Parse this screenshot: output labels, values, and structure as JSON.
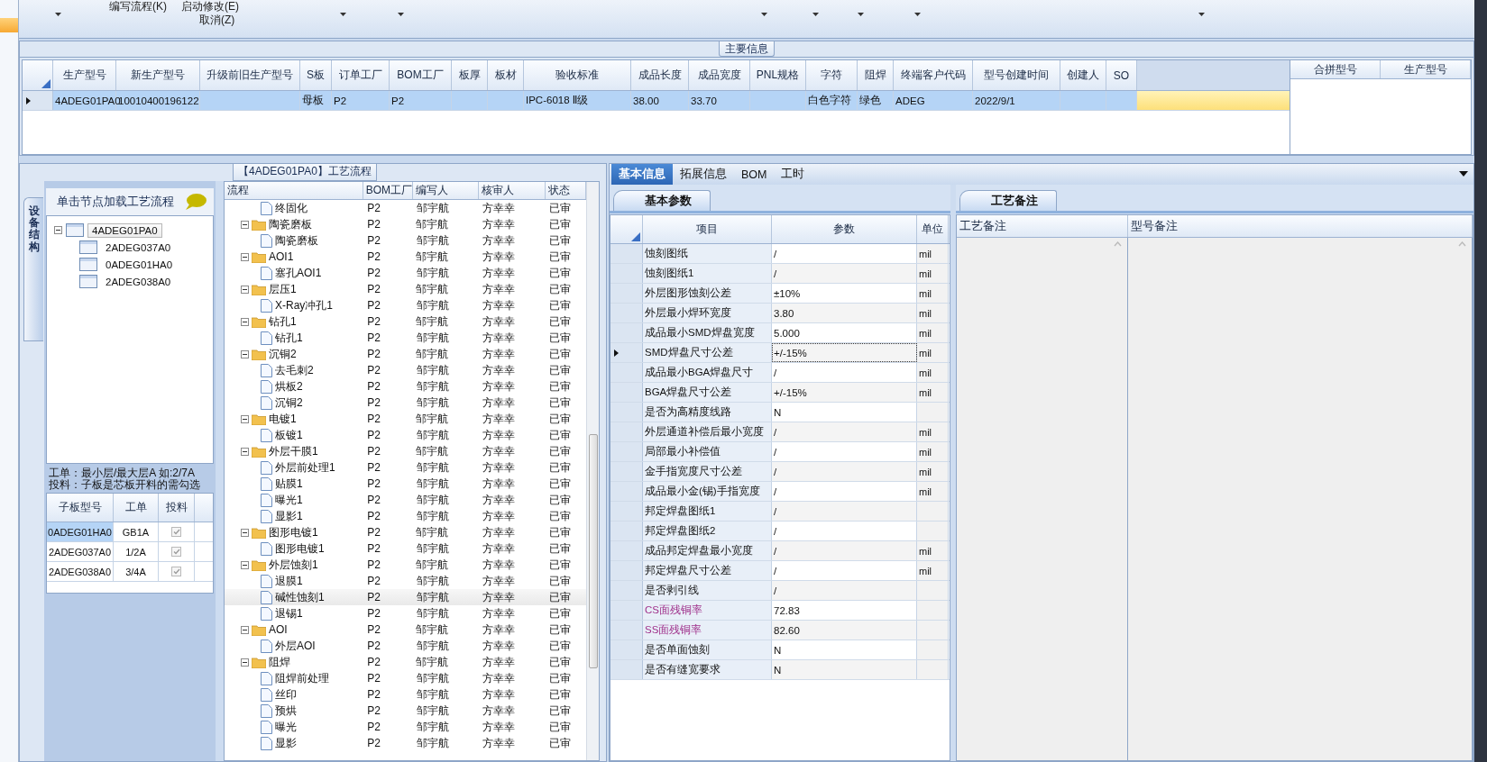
{
  "toolbar": {
    "buttons": [
      {
        "label": "编写流程(K)"
      },
      {
        "label": "启动修改(E)"
      },
      {
        "label": "取消(Z)"
      }
    ]
  },
  "main_info": {
    "title": "主要信息",
    "row_selected": true,
    "columns": [
      {
        "label": "生产型号",
        "value": "4ADEG01PA0"
      },
      {
        "label": "新生产型号",
        "value": "10010400196122"
      },
      {
        "label": "升级前旧生产型号"
      },
      {
        "label": "S板",
        "value": "母板"
      },
      {
        "label": "订单工厂",
        "value": "P2"
      },
      {
        "label": "BOM工厂",
        "value": "P2"
      },
      {
        "label": "板厚"
      },
      {
        "label": "板材"
      },
      {
        "label": "验收标准",
        "value": "IPC-6018 Ⅱ级"
      },
      {
        "label": "成品长度",
        "value": "38.00"
      },
      {
        "label": "成品宽度",
        "value": "33.70"
      },
      {
        "label": "PNL规格"
      },
      {
        "label": "字符",
        "value": "白色字符"
      },
      {
        "label": "阻焊",
        "value": "绿色"
      },
      {
        "label": "终端客户代码",
        "value": "ADEG"
      },
      {
        "label": "型号创建时间",
        "value": "2022/9/1"
      },
      {
        "label": "创建人"
      },
      {
        "label": "SO"
      }
    ],
    "merge_columns": [
      "合拼型号",
      "生产型号"
    ]
  },
  "process": {
    "title": "【4ADEG01PA0】工艺流程",
    "side_tab": "设备结构",
    "hint": "单击节点加载工艺流程",
    "tree": {
      "label": "4ADEG01PA0",
      "expanded": true,
      "selected": true,
      "children": [
        {
          "label": "2ADEG037A0",
          "selected": false
        },
        {
          "label": "0ADEG01HA0",
          "selected": false
        },
        {
          "label": "2ADEG038A0",
          "selected": false
        }
      ]
    },
    "notes": [
      "工单：最小层/最大层A 如:2/7A",
      "投料：子板是芯板开料的需勾选"
    ],
    "sub_columns": [
      "子板型号",
      "工单",
      "投料"
    ],
    "sub_rows": [
      {
        "model": "0ADEG01HA0",
        "order": "GB1A",
        "checked": true,
        "selected": true
      },
      {
        "model": "2ADEG037A0",
        "order": "1/2A",
        "checked": true,
        "selected": false
      },
      {
        "model": "2ADEG038A0",
        "order": "3/4A",
        "checked": true,
        "selected": false
      }
    ],
    "columns": [
      "流程",
      "BOM工厂",
      "编写人",
      "核审人",
      "状态"
    ],
    "groups": [
      {
        "children": [
          {
            "name": "终固化",
            "bom": "P2",
            "writer": "邹宇航",
            "reviewer": "方幸幸",
            "status": "已审",
            "selected": false
          }
        ]
      },
      {
        "name": "陶瓷磨板",
        "bom": "P2",
        "writer": "邹宇航",
        "reviewer": "方幸幸",
        "status": "已审",
        "selected": false,
        "expanded": true,
        "children": [
          {
            "name": "陶瓷磨板",
            "bom": "P2",
            "writer": "邹宇航",
            "reviewer": "方幸幸",
            "status": "已审",
            "selected": false
          }
        ]
      },
      {
        "name": "AOI1",
        "bom": "P2",
        "writer": "邹宇航",
        "reviewer": "方幸幸",
        "status": "已审",
        "selected": false,
        "expanded": true,
        "children": [
          {
            "name": "塞孔AOI1",
            "bom": "P2",
            "writer": "邹宇航",
            "reviewer": "方幸幸",
            "status": "已审",
            "selected": false
          }
        ]
      },
      {
        "name": "层压1",
        "bom": "P2",
        "writer": "邹宇航",
        "reviewer": "方幸幸",
        "status": "已审",
        "selected": false,
        "expanded": true,
        "children": [
          {
            "name": "X-Ray冲孔1",
            "bom": "P2",
            "writer": "邹宇航",
            "reviewer": "方幸幸",
            "status": "已审",
            "selected": false
          }
        ]
      },
      {
        "name": "钻孔1",
        "bom": "P2",
        "writer": "邹宇航",
        "reviewer": "方幸幸",
        "status": "已审",
        "selected": false,
        "expanded": true,
        "children": [
          {
            "name": "钻孔1",
            "bom": "P2",
            "writer": "邹宇航",
            "reviewer": "方幸幸",
            "status": "已审",
            "selected": false
          }
        ]
      },
      {
        "name": "沉铜2",
        "bom": "P2",
        "writer": "邹宇航",
        "reviewer": "方幸幸",
        "status": "已审",
        "selected": false,
        "expanded": true,
        "children": [
          {
            "name": "去毛刺2",
            "bom": "P2",
            "writer": "邹宇航",
            "reviewer": "方幸幸",
            "status": "已审",
            "selected": false
          },
          {
            "name": "烘板2",
            "bom": "P2",
            "writer": "邹宇航",
            "reviewer": "方幸幸",
            "status": "已审",
            "selected": false
          },
          {
            "name": "沉铜2",
            "bom": "P2",
            "writer": "邹宇航",
            "reviewer": "方幸幸",
            "status": "已审",
            "selected": false
          }
        ]
      },
      {
        "name": "电镀1",
        "bom": "P2",
        "writer": "邹宇航",
        "reviewer": "方幸幸",
        "status": "已审",
        "selected": false,
        "expanded": true,
        "children": [
          {
            "name": "板镀1",
            "bom": "P2",
            "writer": "邹宇航",
            "reviewer": "方幸幸",
            "status": "已审",
            "selected": false
          }
        ]
      },
      {
        "name": "外层干膜1",
        "bom": "P2",
        "writer": "邹宇航",
        "reviewer": "方幸幸",
        "status": "已审",
        "selected": false,
        "expanded": true,
        "children": [
          {
            "name": "外层前处理1",
            "bom": "P2",
            "writer": "邹宇航",
            "reviewer": "方幸幸",
            "status": "已审",
            "selected": false
          },
          {
            "name": "贴膜1",
            "bom": "P2",
            "writer": "邹宇航",
            "reviewer": "方幸幸",
            "status": "已审",
            "selected": false
          },
          {
            "name": "曝光1",
            "bom": "P2",
            "writer": "邹宇航",
            "reviewer": "方幸幸",
            "status": "已审",
            "selected": false
          },
          {
            "name": "显影1",
            "bom": "P2",
            "writer": "邹宇航",
            "reviewer": "方幸幸",
            "status": "已审",
            "selected": false
          }
        ]
      },
      {
        "name": "图形电镀1",
        "bom": "P2",
        "writer": "邹宇航",
        "reviewer": "方幸幸",
        "status": "已审",
        "selected": false,
        "expanded": true,
        "children": [
          {
            "name": "图形电镀1",
            "bom": "P2",
            "writer": "邹宇航",
            "reviewer": "方幸幸",
            "status": "已审",
            "selected": false
          }
        ]
      },
      {
        "name": "外层蚀刻1",
        "bom": "P2",
        "writer": "邹宇航",
        "reviewer": "方幸幸",
        "status": "已审",
        "selected": false,
        "expanded": true,
        "children": [
          {
            "name": "退膜1",
            "bom": "P2",
            "writer": "邹宇航",
            "reviewer": "方幸幸",
            "status": "已审",
            "selected": false
          },
          {
            "name": "碱性蚀刻1",
            "bom": "P2",
            "writer": "邹宇航",
            "reviewer": "方幸幸",
            "status": "已审",
            "selected": true
          },
          {
            "name": "退锡1",
            "bom": "P2",
            "writer": "邹宇航",
            "reviewer": "方幸幸",
            "status": "已审",
            "selected": false
          }
        ]
      },
      {
        "name": "AOI",
        "bom": "P2",
        "writer": "邹宇航",
        "reviewer": "方幸幸",
        "status": "已审",
        "selected": false,
        "expanded": true,
        "children": [
          {
            "name": "外层AOI",
            "bom": "P2",
            "writer": "邹宇航",
            "reviewer": "方幸幸",
            "status": "已审",
            "selected": false
          }
        ]
      },
      {
        "name": "阻焊",
        "bom": "P2",
        "writer": "邹宇航",
        "reviewer": "方幸幸",
        "status": "已审",
        "selected": false,
        "expanded": true,
        "children": [
          {
            "name": "阻焊前处理",
            "bom": "P2",
            "writer": "邹宇航",
            "reviewer": "方幸幸",
            "status": "已审",
            "selected": false
          },
          {
            "name": "丝印",
            "bom": "P2",
            "writer": "邹宇航",
            "reviewer": "方幸幸",
            "status": "已审",
            "selected": false
          },
          {
            "name": "预烘",
            "bom": "P2",
            "writer": "邹宇航",
            "reviewer": "方幸幸",
            "status": "已审",
            "selected": false
          },
          {
            "name": "曝光",
            "bom": "P2",
            "writer": "邹宇航",
            "reviewer": "方幸幸",
            "status": "已审",
            "selected": false
          },
          {
            "name": "显影",
            "bom": "P2",
            "writer": "邹宇航",
            "reviewer": "方幸幸",
            "status": "已审",
            "selected": false
          }
        ]
      }
    ]
  },
  "detail": {
    "tabs": [
      {
        "label": "基本信息",
        "selected": true
      },
      {
        "label": "拓展信息",
        "selected": false
      },
      {
        "label": "BOM",
        "selected": false
      },
      {
        "label": "工时",
        "selected": false
      }
    ],
    "sub_tab": "基本参数",
    "columns": [
      "项目",
      "参数",
      "单位"
    ],
    "rows": [
      {
        "item": "蚀刻图纸",
        "value": "/",
        "unit": "mil",
        "selected": false
      },
      {
        "item": "蚀刻图纸1",
        "value": "/",
        "unit": "mil",
        "selected": false
      },
      {
        "item": "外层图形蚀刻公差",
        "value": "±10%",
        "unit": "mil",
        "selected": false
      },
      {
        "item": "外层最小焊环宽度",
        "value": "3.80",
        "unit": "mil",
        "selected": false
      },
      {
        "item": "成品最小SMD焊盘宽度",
        "value": "5.000",
        "unit": "mil",
        "selected": false
      },
      {
        "item": "SMD焊盘尺寸公差",
        "value": "+/-15%",
        "unit": "mil",
        "selected": true
      },
      {
        "item": "成品最小BGA焊盘尺寸",
        "value": "/",
        "unit": "mil",
        "selected": false
      },
      {
        "item": "BGA焊盘尺寸公差",
        "value": "+/-15%",
        "unit": "mil",
        "selected": false
      },
      {
        "item": "是否为高精度线路",
        "value": "N",
        "selected": false
      },
      {
        "item": "外层通道补偿后最小宽度",
        "value": "/",
        "unit": "mil",
        "selected": false
      },
      {
        "item": "局部最小补偿值",
        "value": "/",
        "unit": "mil",
        "selected": false
      },
      {
        "item": "金手指宽度尺寸公差",
        "value": "/",
        "unit": "mil",
        "selected": false
      },
      {
        "item": "成品最小金(锡)手指宽度",
        "value": "/",
        "unit": "mil",
        "selected": false
      },
      {
        "item": "邦定焊盘图纸1",
        "value": "/",
        "selected": false
      },
      {
        "item": "邦定焊盘图纸2",
        "value": "/",
        "selected": false
      },
      {
        "item": "成品邦定焊盘最小宽度",
        "value": "/",
        "unit": "mil",
        "selected": false
      },
      {
        "item": "邦定焊盘尺寸公差",
        "value": "/",
        "unit": "mil",
        "selected": false
      },
      {
        "item": "是否剥引线",
        "value": "/",
        "selected": false
      },
      {
        "item": "CS面残铜率",
        "value": "72.83",
        "color": "#a0328c",
        "selected": false
      },
      {
        "item": "SS面残铜率",
        "value": "82.60",
        "color": "#a0328c",
        "selected": false
      },
      {
        "item": "是否单面蚀刻",
        "value": "N",
        "selected": false
      },
      {
        "item": "是否有缝宽要求",
        "value": "N",
        "selected": false
      }
    ]
  },
  "remarks": {
    "tab": "工艺备注",
    "columns": [
      "工艺备注",
      "型号备注"
    ]
  }
}
